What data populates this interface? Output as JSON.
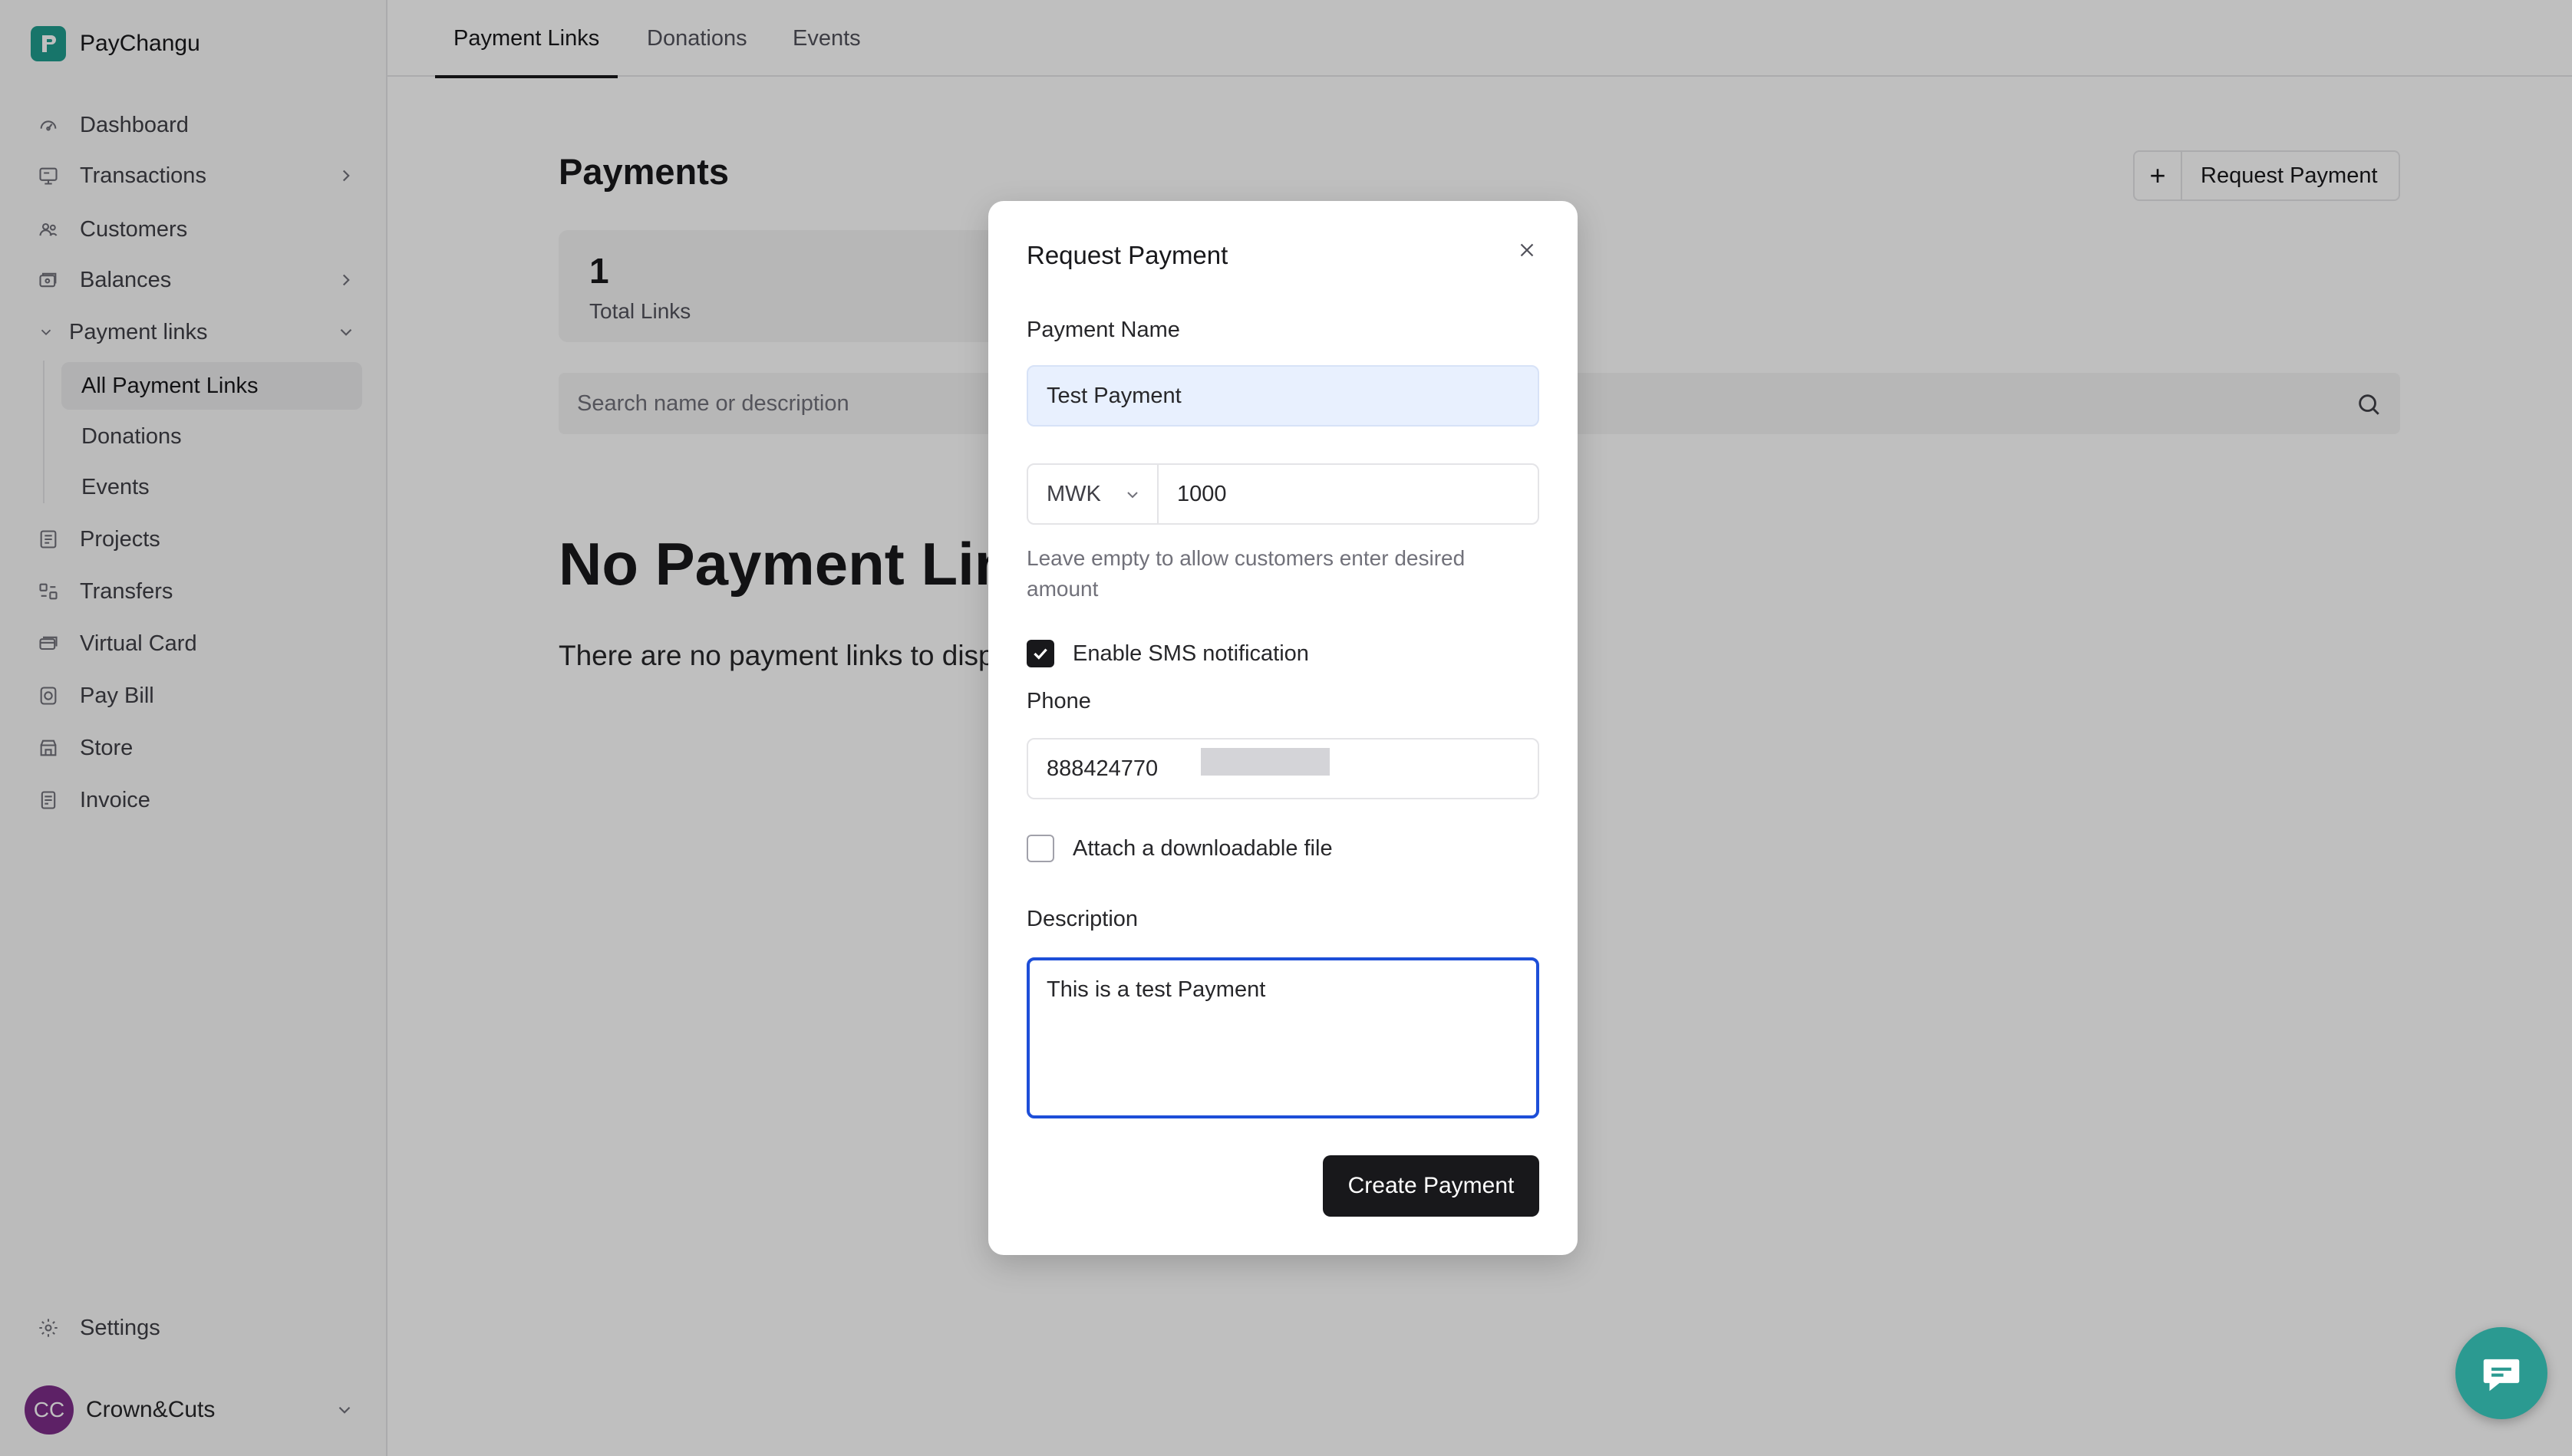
{
  "app": {
    "name": "PayChangu"
  },
  "sidebar": {
    "items": [
      {
        "label": "Dashboard"
      },
      {
        "label": "Transactions"
      },
      {
        "label": "Customers"
      },
      {
        "label": "Balances"
      },
      {
        "label": "Payment links"
      },
      {
        "label": "Projects"
      },
      {
        "label": "Transfers"
      },
      {
        "label": "Virtual Card"
      },
      {
        "label": "Pay Bill"
      },
      {
        "label": "Store"
      },
      {
        "label": "Invoice"
      },
      {
        "label": "Settings"
      }
    ],
    "payment_links_sub": [
      {
        "label": "All Payment Links",
        "active": true
      },
      {
        "label": "Donations"
      },
      {
        "label": "Events"
      }
    ],
    "account": {
      "initials": "CC",
      "name": "Crown&Cuts"
    }
  },
  "tabs": [
    {
      "label": "Payment Links",
      "active": true
    },
    {
      "label": "Donations"
    },
    {
      "label": "Events"
    }
  ],
  "main": {
    "title": "Payments",
    "request_button": "Request Payment",
    "stats": {
      "value": "1",
      "label": "Total Links"
    },
    "search_placeholder": "Search name or description",
    "empty_title": "No Payment Links",
    "empty_text": "There are no payment links to display"
  },
  "modal": {
    "title": "Request Payment",
    "payment_name_label": "Payment Name",
    "payment_name_value": "Test Payment",
    "currency": "MWK",
    "amount": "1000",
    "amount_hint": "Leave empty to allow customers enter desired amount",
    "sms_label": "Enable SMS notification",
    "sms_checked": true,
    "phone_label": "Phone",
    "phone_value": "888424770",
    "attach_label": "Attach a downloadable file",
    "attach_checked": false,
    "description_label": "Description",
    "description_value": "This is a test Payment",
    "submit_label": "Create Payment"
  },
  "colors": {
    "brand": "#1f9c8e",
    "primary_button": "#18181b",
    "focus_ring": "#1d4ed8",
    "avatar": "#7c2d88",
    "chat": "#2b9a91"
  }
}
